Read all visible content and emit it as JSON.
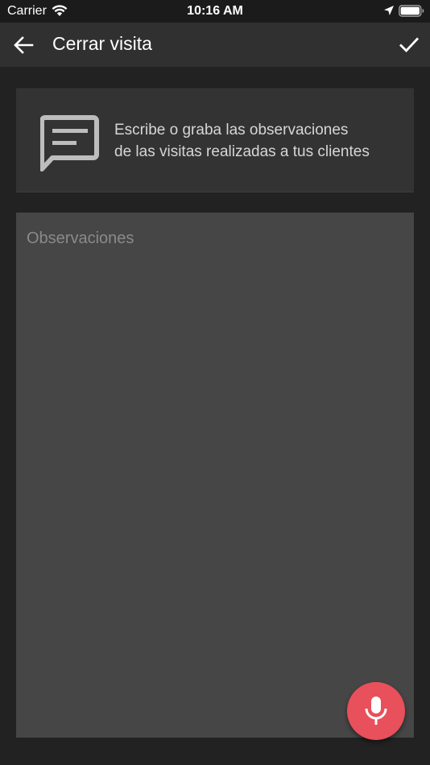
{
  "status_bar": {
    "carrier": "Carrier",
    "time": "10:16 AM",
    "icons": [
      "wifi-icon",
      "location-arrow-icon",
      "battery-icon"
    ]
  },
  "app_bar": {
    "title": "Cerrar visita",
    "back_icon": "arrow-left-icon",
    "confirm_icon": "checkmark-icon",
    "background": "#303030"
  },
  "info_card": {
    "icon": "chat-bubble-icon",
    "line1": "Escribe o graba las observaciones",
    "line2": "de las visitas realizadas a tus clientes"
  },
  "notes": {
    "placeholder": "Observaciones",
    "value": ""
  },
  "mic_button": {
    "icon": "microphone-icon",
    "color": "#e8505b"
  },
  "colors": {
    "background": "#222222",
    "card": "#333333",
    "input": "#464646",
    "accent": "#e8505b"
  }
}
